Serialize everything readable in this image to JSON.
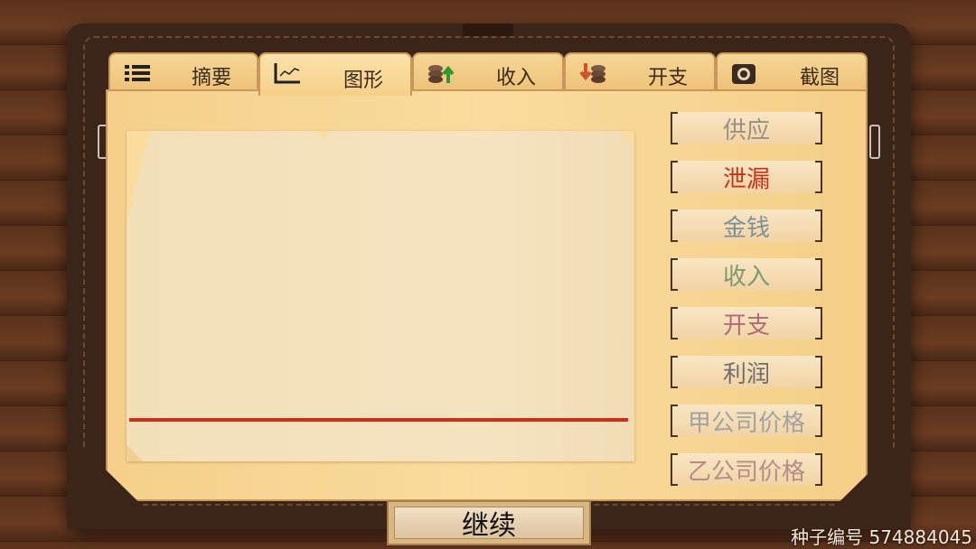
{
  "tabs": [
    {
      "label": "摘要",
      "icon": "list-icon"
    },
    {
      "label": "图形",
      "icon": "line-chart-icon",
      "active": true
    },
    {
      "label": "收入",
      "icon": "coins-up-icon"
    },
    {
      "label": "开支",
      "icon": "coins-down-icon"
    },
    {
      "label": "截图",
      "icon": "camera-icon"
    }
  ],
  "legend_buttons": [
    {
      "label": "供应",
      "color": "#9a8f86"
    },
    {
      "label": "泄漏",
      "color": "#c9321a"
    },
    {
      "label": "金钱",
      "color": "#7f8f99"
    },
    {
      "label": "收入",
      "color": "#7f9a6a"
    },
    {
      "label": "开支",
      "color": "#b06a7a"
    },
    {
      "label": "利润",
      "color": "#6e6e6e"
    },
    {
      "label": "甲公司价格",
      "color": "#a2a2a2"
    },
    {
      "label": "乙公司价格",
      "color": "#b38e86"
    }
  ],
  "graph": {
    "series_shown": "泄漏",
    "line_color": "#c9321a"
  },
  "continue_label": "继续",
  "seed_text": "种子编号 574884045"
}
